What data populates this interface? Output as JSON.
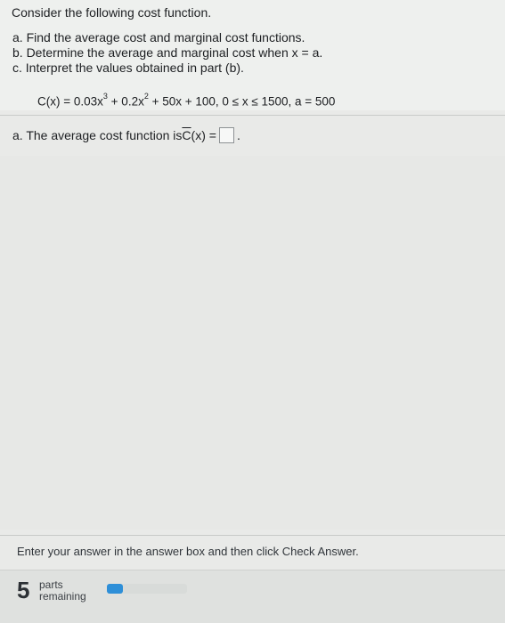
{
  "question": {
    "intro": "Consider the following cost function.",
    "parts": [
      "a. Find the average cost and marginal cost functions.",
      "b. Determine the average and marginal cost when x = a.",
      "c. Interpret the values obtained in part (b)."
    ],
    "formula": {
      "lhs": "C(x) = 0.03x",
      "exp1": "3",
      "mid": " + 0.2x",
      "exp2": "2",
      "rest": " + 50x + 100, 0 ≤ x ≤ 1500, a = 500"
    }
  },
  "answer": {
    "prefix": "a. The average cost function is ",
    "func": "C",
    "suffix": "(x) = ",
    "trailing": "."
  },
  "instructions": "Enter your answer in the answer box and then click Check Answer.",
  "progress": {
    "number": "5",
    "line1": "parts",
    "line2": "remaining",
    "fraction_complete": 0.2,
    "color": "#2e8fd8"
  }
}
